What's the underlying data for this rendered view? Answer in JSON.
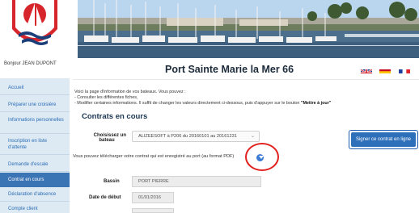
{
  "user": {
    "greeting": "Bonjour JEAN DUPONT"
  },
  "header": {
    "title": "Port Sainte Marie la Mer 66"
  },
  "languages": [
    "English",
    "Español",
    "Français"
  ],
  "sidebar": {
    "items": [
      {
        "label": "Accueil",
        "active": false
      },
      {
        "label": "Préparer une croisière",
        "active": false
      },
      {
        "label": "Informations personnelles",
        "active": false
      },
      {
        "label": "Inscription en liste d'attente",
        "active": false
      },
      {
        "label": "Demande d'escale",
        "active": false
      },
      {
        "label": "Contrat en cours",
        "active": true
      },
      {
        "label": "Déclaration d'absence",
        "active": false
      },
      {
        "label": "Compte client",
        "active": false
      }
    ]
  },
  "intro": {
    "line1": "Voici la page d'information de vos bateaux. Vous pouvez :",
    "line2": "- Consulter les différentes fiches,",
    "line3_prefix": "- Modifier certaines informations. Il suffit de changer les valeurs directement ci-dessous, puis d'appuyer sur le bouton ",
    "line3_bold": "\"Mettre à jour\""
  },
  "section": {
    "title": "Contrats en cours"
  },
  "form": {
    "boat_label": "Choisissez un bateau",
    "boat_label_line1": "Choisissez un",
    "boat_label_line2": "bateau",
    "boat_value": "ALIZEESOFT à P206 du 20160101 au 20161231",
    "sign_button": "Signer ce contrat en ligne",
    "download_text": "Vous pouvez télécharger votre contrat qui est enregistré au port (au format PDF)",
    "bassin_label": "Bassin",
    "bassin_value": "PORT PIERRE",
    "date_label": "Date de début",
    "date_value": "01/01/2016"
  },
  "colors": {
    "accent": "#2e6fba",
    "sidebar_bg": "#dde9f3",
    "highlight": "#e0211f"
  },
  "icons": {
    "download": "download-icon",
    "dropdown": "chevron-down-icon"
  }
}
